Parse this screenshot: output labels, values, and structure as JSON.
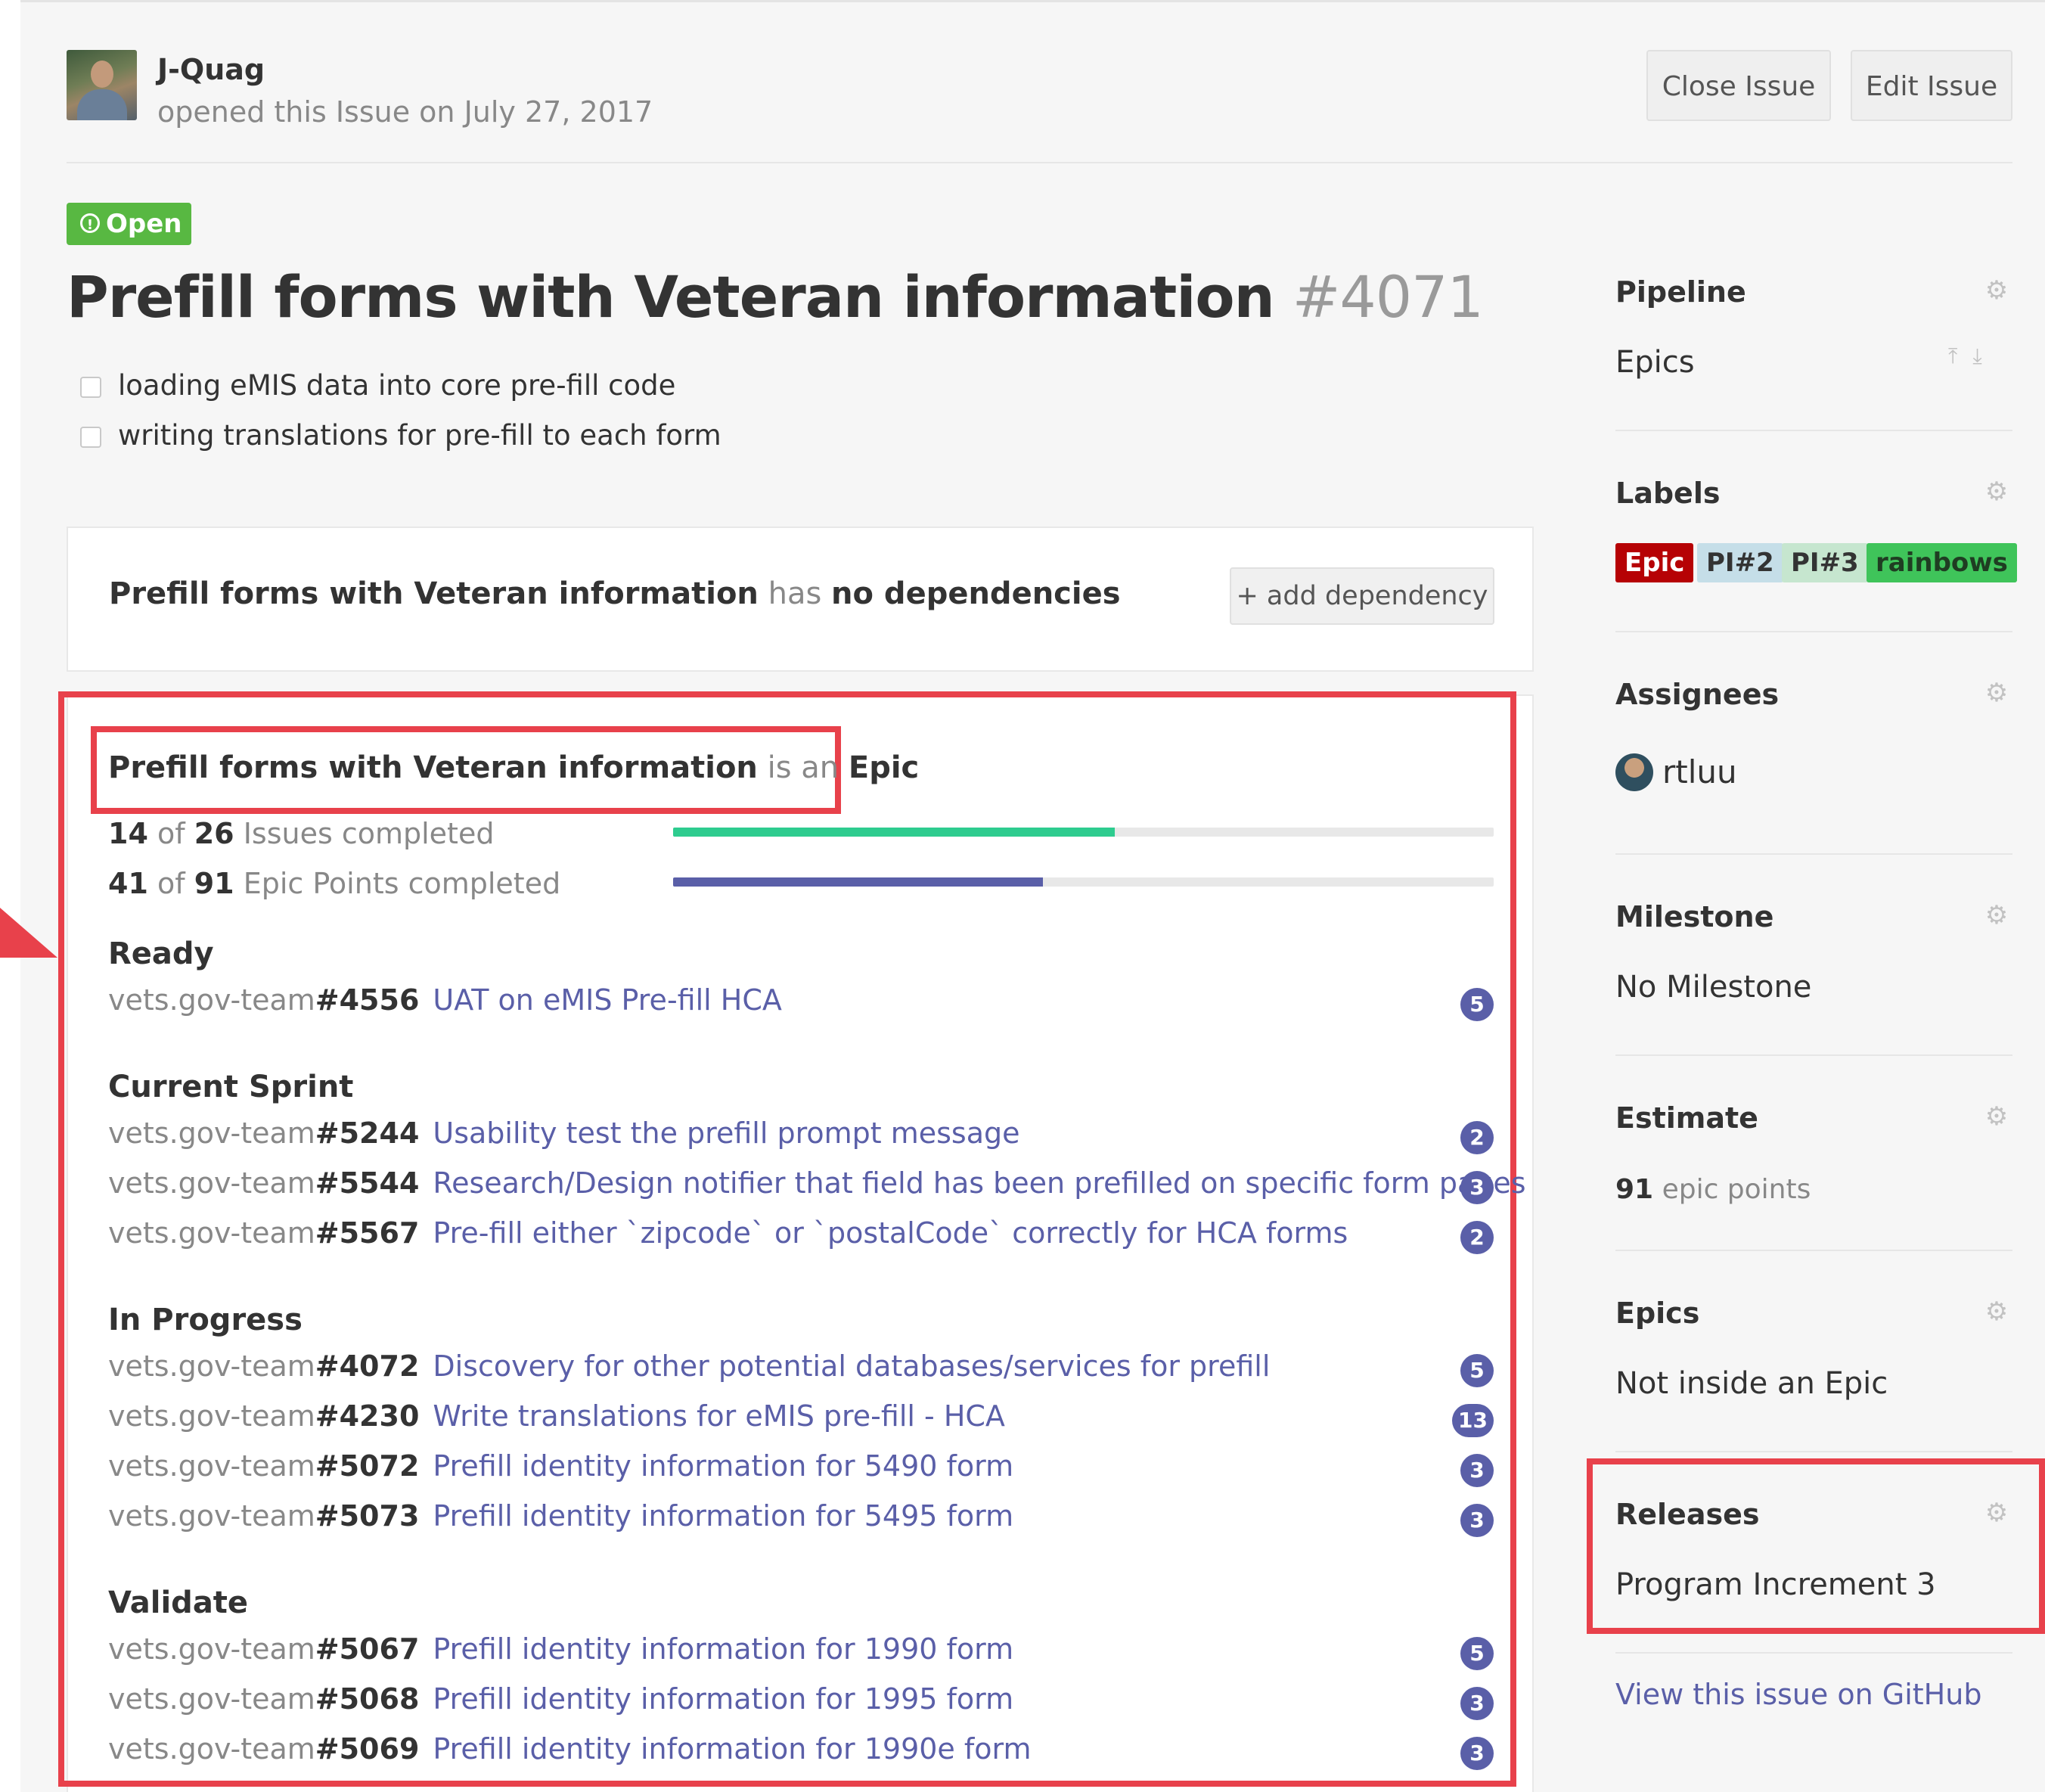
{
  "header": {
    "author": "J-Quag",
    "opened_text": "opened this Issue on July 27, 2017",
    "close_button": "Close Issue",
    "edit_button": "Edit Issue"
  },
  "issue": {
    "status": "Open",
    "title": "Prefill forms with Veteran information",
    "number": "#4071",
    "tasks": [
      {
        "label": "loading eMIS data into core pre-fill code",
        "checked": false
      },
      {
        "label": "writing translations for pre-fill to each form",
        "checked": false
      }
    ]
  },
  "dependencies": {
    "subject": "Prefill forms with Veteran information",
    "connector": "has",
    "status": "no dependencies",
    "add_button": "+ add dependency"
  },
  "epic": {
    "subject": "Prefill forms with Veteran information",
    "connector": "is an",
    "kind": "Epic",
    "issues_progress": {
      "done": "14",
      "of": "of",
      "total": "26",
      "label": "Issues completed",
      "fraction": 0.538,
      "color": "#2ecc8f"
    },
    "points_progress": {
      "done": "41",
      "of": "of",
      "total": "91",
      "label": "Epic Points completed",
      "fraction": 0.451,
      "color": "#5a5fa8"
    },
    "groups": [
      {
        "title": "Ready",
        "issues": [
          {
            "repo": "vets.gov-team",
            "number": "#4556",
            "title": "UAT on eMIS Pre-fill HCA",
            "points": "5"
          }
        ]
      },
      {
        "title": "Current Sprint",
        "issues": [
          {
            "repo": "vets.gov-team",
            "number": "#5244",
            "title": "Usability test the prefill prompt message",
            "points": "2"
          },
          {
            "repo": "vets.gov-team",
            "number": "#5544",
            "title": "Research/Design notifier that field has been prefilled on specific form pages",
            "points": "3"
          },
          {
            "repo": "vets.gov-team",
            "number": "#5567",
            "title": "Pre-fill either `zipcode` or `postalCode` correctly for HCA forms",
            "points": "2"
          }
        ]
      },
      {
        "title": "In Progress",
        "issues": [
          {
            "repo": "vets.gov-team",
            "number": "#4072",
            "title": "Discovery for other potential databases/services for prefill",
            "points": "5"
          },
          {
            "repo": "vets.gov-team",
            "number": "#4230",
            "title": "Write translations for eMIS pre-fill - HCA",
            "points": "13"
          },
          {
            "repo": "vets.gov-team",
            "number": "#5072",
            "title": "Prefill identity information for 5490 form",
            "points": "3"
          },
          {
            "repo": "vets.gov-team",
            "number": "#5073",
            "title": "Prefill identity information for 5495 form",
            "points": "3"
          }
        ]
      },
      {
        "title": "Validate",
        "issues": [
          {
            "repo": "vets.gov-team",
            "number": "#5067",
            "title": "Prefill identity information for 1990 form",
            "points": "5"
          },
          {
            "repo": "vets.gov-team",
            "number": "#5068",
            "title": "Prefill identity information for 1995 form",
            "points": "3"
          },
          {
            "repo": "vets.gov-team",
            "number": "#5069",
            "title": "Prefill identity information for 1990e form",
            "points": "3"
          }
        ]
      }
    ]
  },
  "sidebar": {
    "pipeline": {
      "title": "Pipeline",
      "value": "Epics"
    },
    "labels": {
      "title": "Labels",
      "items": [
        {
          "text": "Epic",
          "bg": "#b60205",
          "fg": "#ffffff"
        },
        {
          "text": "PI#2",
          "bg": "#c5dee8",
          "fg": "#333333"
        },
        {
          "text": "PI#3",
          "bg": "#c6e6cf",
          "fg": "#333333"
        },
        {
          "text": "rainbows",
          "bg": "#3fc45a",
          "fg": "#1f3d22"
        }
      ]
    },
    "assignees": {
      "title": "Assignees",
      "name": "rtluu"
    },
    "milestone": {
      "title": "Milestone",
      "value": "No Milestone"
    },
    "estimate": {
      "title": "Estimate",
      "number": "91",
      "unit": "epic points"
    },
    "epics": {
      "title": "Epics",
      "value": "Not inside an Epic"
    },
    "releases": {
      "title": "Releases",
      "value": "Program Increment 3"
    },
    "github_link": "View this issue on GitHub"
  },
  "icons": {
    "gear": "gear-icon",
    "move_top": "move-to-top-icon",
    "move_bottom": "move-to-bottom-icon",
    "open_status": "issue-opened-icon",
    "highlight_arrow": "annotation-arrow-icon"
  },
  "colors": {
    "open_badge": "#58b842",
    "link": "#5a5fa8",
    "highlight": "#e8414b"
  }
}
